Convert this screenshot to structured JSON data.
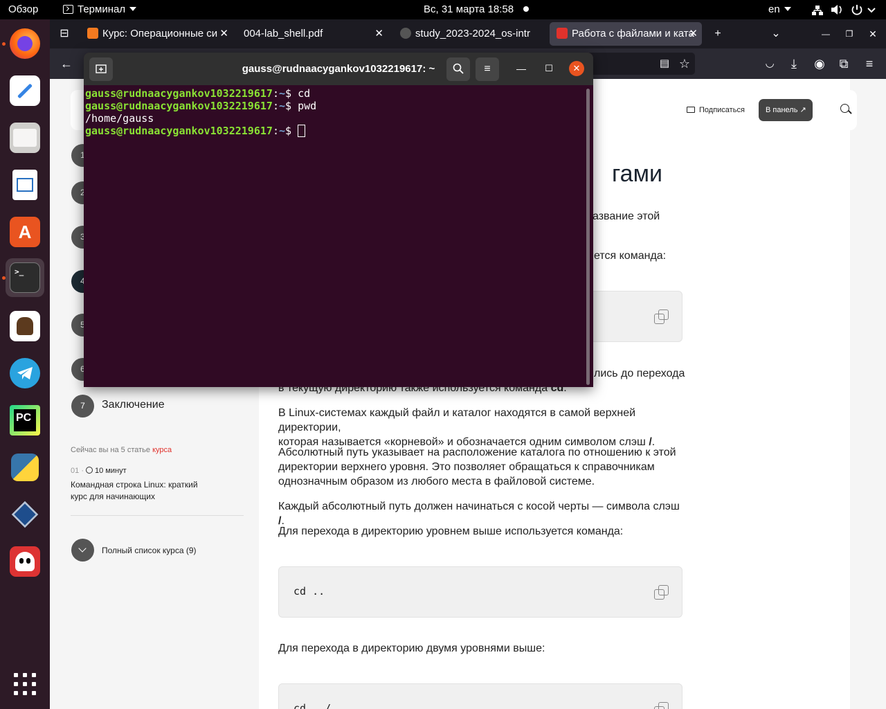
{
  "topbar": {
    "overview": "Обзор",
    "app_menu": "Терминал",
    "datetime": "Вс, 31 марта  18:58",
    "lang": "en"
  },
  "dock": {
    "items": [
      "firefox-icon",
      "text-editor-icon",
      "files-icon",
      "writer-icon",
      "app-center-icon",
      "terminal-icon",
      "docs-icon",
      "telegram-icon",
      "pycharm-icon",
      "python-icon",
      "virtualbox-icon",
      "ghost-icon"
    ],
    "apps_grid": "show-apps-icon"
  },
  "browser": {
    "tabs": [
      {
        "label": "Курс: Операционные си",
        "fav_color": "#f47a20"
      },
      {
        "label": "004-lab_shell.pdf",
        "fav_color": "#1c1b22"
      },
      {
        "label": "study_2023-2024_os-intr",
        "fav_color": "#333333"
      },
      {
        "label": "Работа с файлами и ката",
        "fav_color": "#e0322c"
      }
    ],
    "new_tab": "+",
    "list_tabs": "⌄",
    "minimize": "—",
    "restore": "❐",
    "close": "✕"
  },
  "website": {
    "subscribe": "Подписаться",
    "panel_button": "В панель",
    "title_tail": "гами",
    "steps": [
      {
        "num": "1",
        "label": ""
      },
      {
        "num": "2",
        "label": ""
      },
      {
        "num": "3",
        "label": ""
      },
      {
        "num": "4",
        "label": ""
      },
      {
        "num": "5",
        "label": ""
      },
      {
        "num": "6",
        "label": ""
      },
      {
        "num": "7",
        "label": "Заключение"
      }
    ],
    "course_progress_prefix": "Сейчас вы на 5 статье",
    "course_progress_link": "курса",
    "lesson_num": "01",
    "lesson_time": "10 минут",
    "lesson_title_1": "Командная строка Linux: краткий",
    "lesson_title_2": "курс для начинающих",
    "full_list": "Полный список курса (9)",
    "fragments": {
      "p1_tail": "азвание этой",
      "p2_tail": "ется команда:",
      "p3_tail": "лись до перехода",
      "p3_line2": "в текущую директорию также используется команда"
    },
    "p3_bold": "cd",
    "p4_line1": "В Linux-системах каждый файл и каталог находятся в самой верхней директории,",
    "p4_line2": "которая называется «корневой» и обозначается одним символом слэш",
    "p4_bold": "/",
    "p5_line1": "Абсолютный путь указывает на расположение каталога по отношению к этой",
    "p5_line2": "директории верхнего уровня. Это позволяет обращаться к справочникам",
    "p5_line3": "однозначным образом из любого места в файловой системе.",
    "p6": "Каждый абсолютный путь должен начинаться с косой черты — символа слэш",
    "p6_bold": "/",
    "p7": "Для перехода в директорию уровнем выше используется команда:",
    "code1": "cd ..",
    "p8": "Для перехода в директорию двумя уровнями выше:",
    "code2": "cd ../.."
  },
  "terminal": {
    "title": "gauss@rudnaacygankov1032219617: ~",
    "lines": [
      {
        "user": "gauss@rudnaacygankov1032219617",
        "path": "~",
        "cmd": "cd"
      },
      {
        "user": "gauss@rudnaacygankov1032219617",
        "path": "~",
        "cmd": "pwd"
      },
      {
        "output": "/home/gauss"
      },
      {
        "user": "gauss@rudnaacygankov1032219617",
        "path": "~",
        "cmd": ""
      }
    ]
  }
}
